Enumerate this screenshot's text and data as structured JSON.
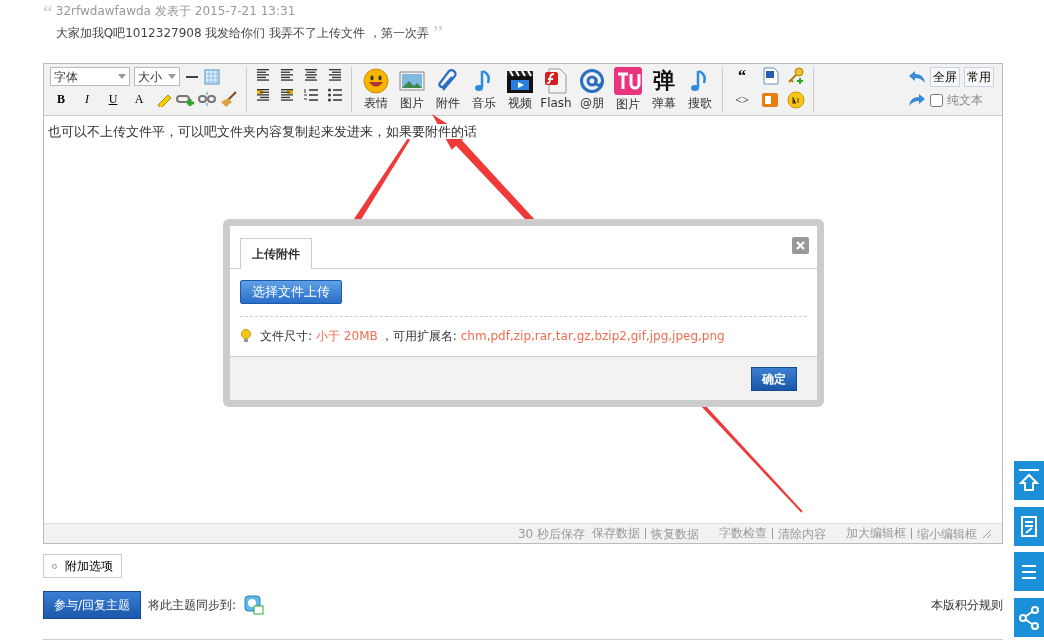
{
  "quote": {
    "open_mark": "“",
    "author": "32rfwdawfawda",
    "meta": "发表于 2015-7-21 13:31",
    "text": "大家加我Q吧1012327908  我发给你们 我弄不了上传文件 ，第一次弄",
    "close_mark": "”"
  },
  "toolbar": {
    "font_select": "字体",
    "size_select": "大小",
    "format_buttons": [
      {
        "kind": "bold",
        "label": "B"
      },
      {
        "kind": "italic",
        "label": "I"
      },
      {
        "kind": "underline",
        "label": "U"
      },
      {
        "kind": "color",
        "label": "A"
      }
    ],
    "media_buttons": [
      {
        "kind": "smiley",
        "label": "表情"
      },
      {
        "kind": "image",
        "label": "图片"
      },
      {
        "kind": "clip",
        "label": "附件"
      },
      {
        "kind": "music",
        "label": "音乐"
      },
      {
        "kind": "video",
        "label": "视频"
      },
      {
        "kind": "flash",
        "label": "Flash"
      },
      {
        "kind": "at",
        "label": "@朋"
      },
      {
        "kind": "tu",
        "label": "图片"
      },
      {
        "kind": "danmu",
        "label": "弹幕",
        "glyph": "弹"
      },
      {
        "kind": "music",
        "label": "搜歌"
      }
    ],
    "quote_mark": "“",
    "code_mark": "<>",
    "fullscreen": "全屏",
    "common": "常用",
    "plain_text": {
      "label": "纯文本",
      "checked": false
    }
  },
  "editor": {
    "content": "也可以不上传文件平，可以吧文件夹内容复制起来发进来，如果要附件的话",
    "autosave": "30 秒后保存",
    "footer_links": [
      {
        "label": "保存数据",
        "sep": true
      },
      {
        "label": "恢复数据",
        "sep": false
      },
      {
        "label": "字数检查",
        "sep": true
      },
      {
        "label": "清除内容",
        "sep": false
      },
      {
        "label": "加大编辑框",
        "sep": true
      },
      {
        "label": "缩小编辑框",
        "sep": false
      }
    ]
  },
  "dialog": {
    "tab": "上传附件",
    "upload_button": "选择文件上传",
    "size_label": "文件尺寸:",
    "size_value": "小于 20MB",
    "ext_label": "，可用扩展名:",
    "ext_value": "chm,pdf,zip,rar,tar,gz,bzip2,gif,jpg,jpeg,png",
    "ok": "确定"
  },
  "extra_options": "附加选项",
  "reply_button": "参与/回复主题",
  "sync_label": "将此主题同步到:",
  "rules_link": "本版积分规则"
}
